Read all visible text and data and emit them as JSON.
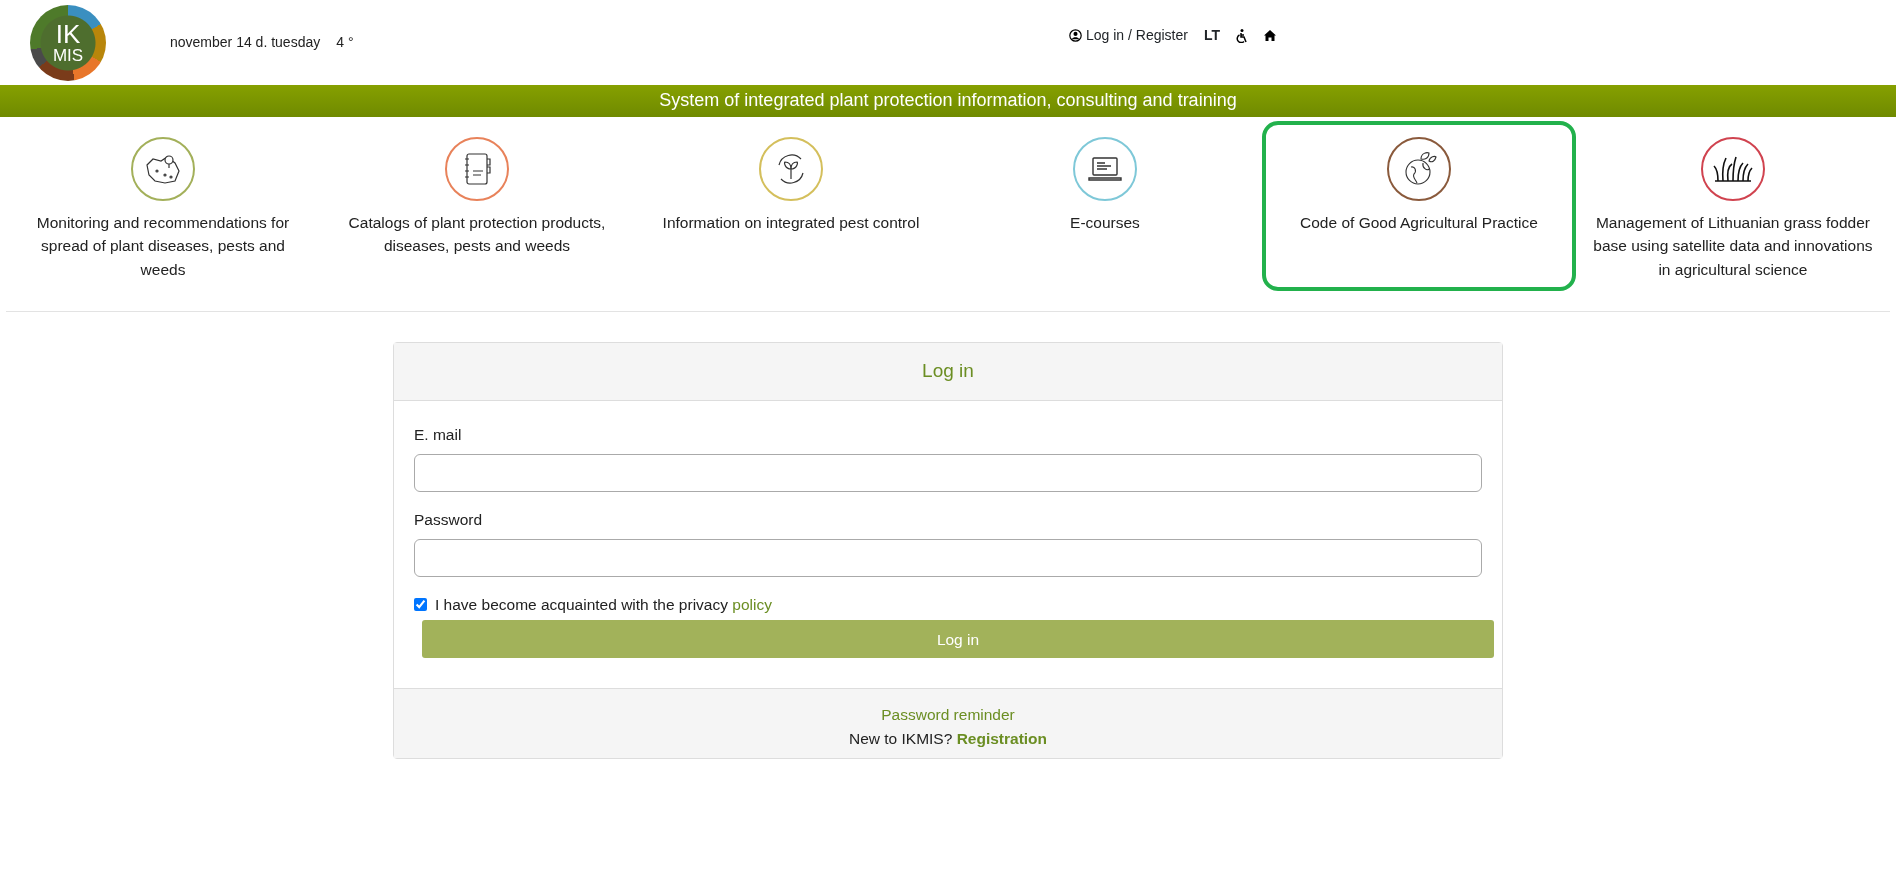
{
  "header": {
    "logo_text": [
      "IK",
      "MIS"
    ],
    "date": "november 14 d. tuesday",
    "temperature": "4 °",
    "login_link": "Log in / Register",
    "language": "LT"
  },
  "banner": "System of integrated plant protection information, consulting and training",
  "categories": [
    {
      "label": "Monitoring and recommendations for spread of plant diseases, pests and weeds",
      "color": "#a3b05a",
      "highlighted": false
    },
    {
      "label": "Catalogs of plant protection products, diseases, pests and weeds",
      "color": "#e8825a",
      "highlighted": false
    },
    {
      "label": "Information on integrated pest control",
      "color": "#d4bf5c",
      "highlighted": false
    },
    {
      "label": "E-courses",
      "color": "#7ec8d8",
      "highlighted": false
    },
    {
      "label": "Code of Good Agricultural Practice",
      "color": "#8a5a3c",
      "highlighted": true
    },
    {
      "label": "Management of Lithuanian grass fodder base using satellite data and innovations in agricultural science",
      "color": "#d0434f",
      "highlighted": false
    }
  ],
  "login": {
    "title": "Log in",
    "email_label": "E. mail",
    "password_label": "Password",
    "privacy_text": "I have become acquainted with the privacy",
    "privacy_link": "policy",
    "privacy_checked": true,
    "submit": "Log in",
    "reminder": "Password reminder",
    "new_text": "New to IKMIS?",
    "registration": "Registration"
  }
}
